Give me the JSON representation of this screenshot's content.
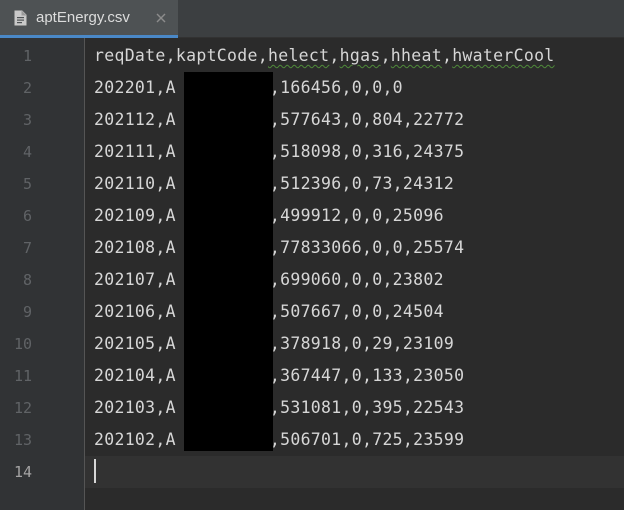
{
  "tab": {
    "title": "aptEnergy.csv",
    "icon": "file-icon",
    "close_icon": "close-icon"
  },
  "editor": {
    "line_numbers": [
      "1",
      "2",
      "3",
      "4",
      "5",
      "6",
      "7",
      "8",
      "9",
      "10",
      "11",
      "12",
      "13",
      "14"
    ],
    "active_line": "14",
    "header": {
      "col1": "reqDate",
      "col2": "kaptCode",
      "col3": "helect",
      "col4": "hgas",
      "col5": "hheat",
      "col6": "hwaterCool"
    },
    "rows": [
      {
        "prefix": "202201,A",
        "suffix": ",166456,0,0,0"
      },
      {
        "prefix": "202112,A",
        "suffix": ",577643,0,804,22772"
      },
      {
        "prefix": "202111,A",
        "suffix": ",518098,0,316,24375"
      },
      {
        "prefix": "202110,A",
        "suffix": ",512396,0,73,24312"
      },
      {
        "prefix": "202109,A",
        "suffix": ",499912,0,0,25096"
      },
      {
        "prefix": "202108,A",
        "suffix": ",77833066,0,0,25574"
      },
      {
        "prefix": "202107,A",
        "suffix": ",699060,0,0,23802"
      },
      {
        "prefix": "202106,A",
        "suffix": ",507667,0,0,24504"
      },
      {
        "prefix": "202105,A",
        "suffix": ",378918,0,29,23109"
      },
      {
        "prefix": "202104,A",
        "suffix": ",367447,0,133,23050"
      },
      {
        "prefix": "202103,A",
        "suffix": ",531081,0,395,22543"
      },
      {
        "prefix": "202102,A",
        "suffix": ",506701,0,725,23599"
      }
    ]
  },
  "colors": {
    "background": "#2b2b2b",
    "gutter": "#313335",
    "tab_active": "#4e5254",
    "tab_underline": "#4a88c7",
    "text": "#d6d6d6",
    "line_number": "#606366",
    "redaction": "#000000"
  }
}
